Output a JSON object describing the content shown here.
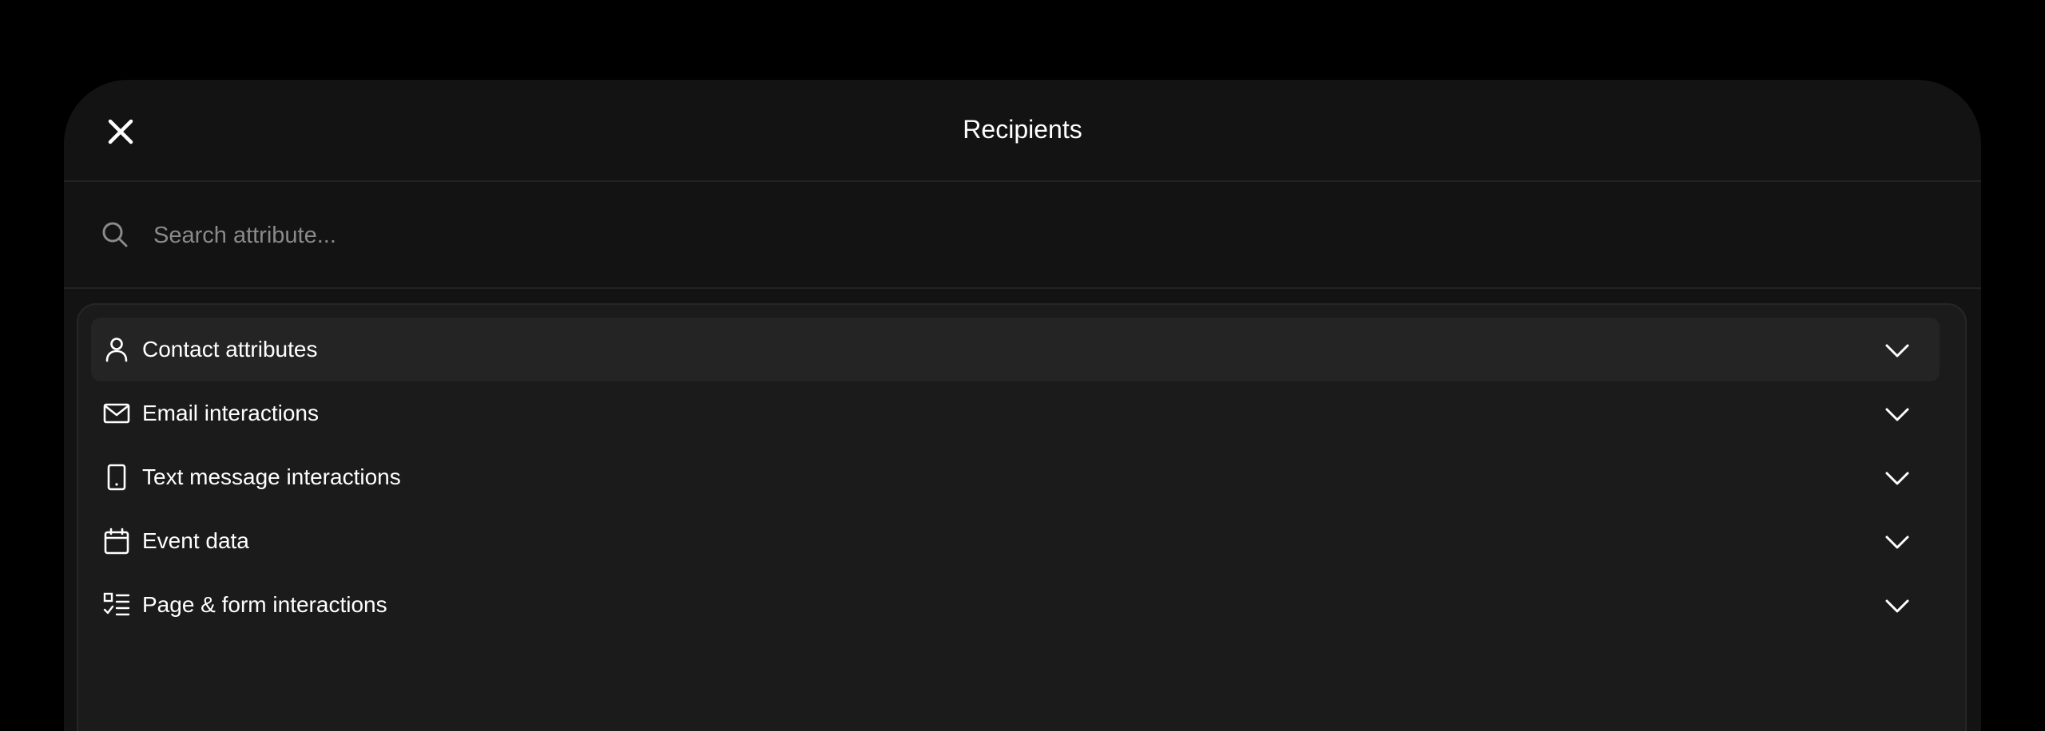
{
  "header": {
    "title": "Recipients",
    "close_icon": "close-icon"
  },
  "search": {
    "placeholder": "Search attribute...",
    "value": "",
    "icon": "search-icon"
  },
  "categories": [
    {
      "label": "Contact attributes",
      "icon": "user-icon",
      "expanded": false,
      "highlighted": true
    },
    {
      "label": "Email interactions",
      "icon": "envelope-icon",
      "expanded": false,
      "highlighted": false
    },
    {
      "label": "Text message interactions",
      "icon": "phone-icon",
      "expanded": false,
      "highlighted": false
    },
    {
      "label": "Event data",
      "icon": "calendar-icon",
      "expanded": false,
      "highlighted": false
    },
    {
      "label": "Page & form interactions",
      "icon": "checklist-icon",
      "expanded": false,
      "highlighted": false
    }
  ],
  "colors": {
    "background": "#000000",
    "sheet": "#131313",
    "panel": "#1b1b1b",
    "highlight_row": "#242424",
    "text": "#ffffff",
    "placeholder": "#8a8a8a"
  }
}
